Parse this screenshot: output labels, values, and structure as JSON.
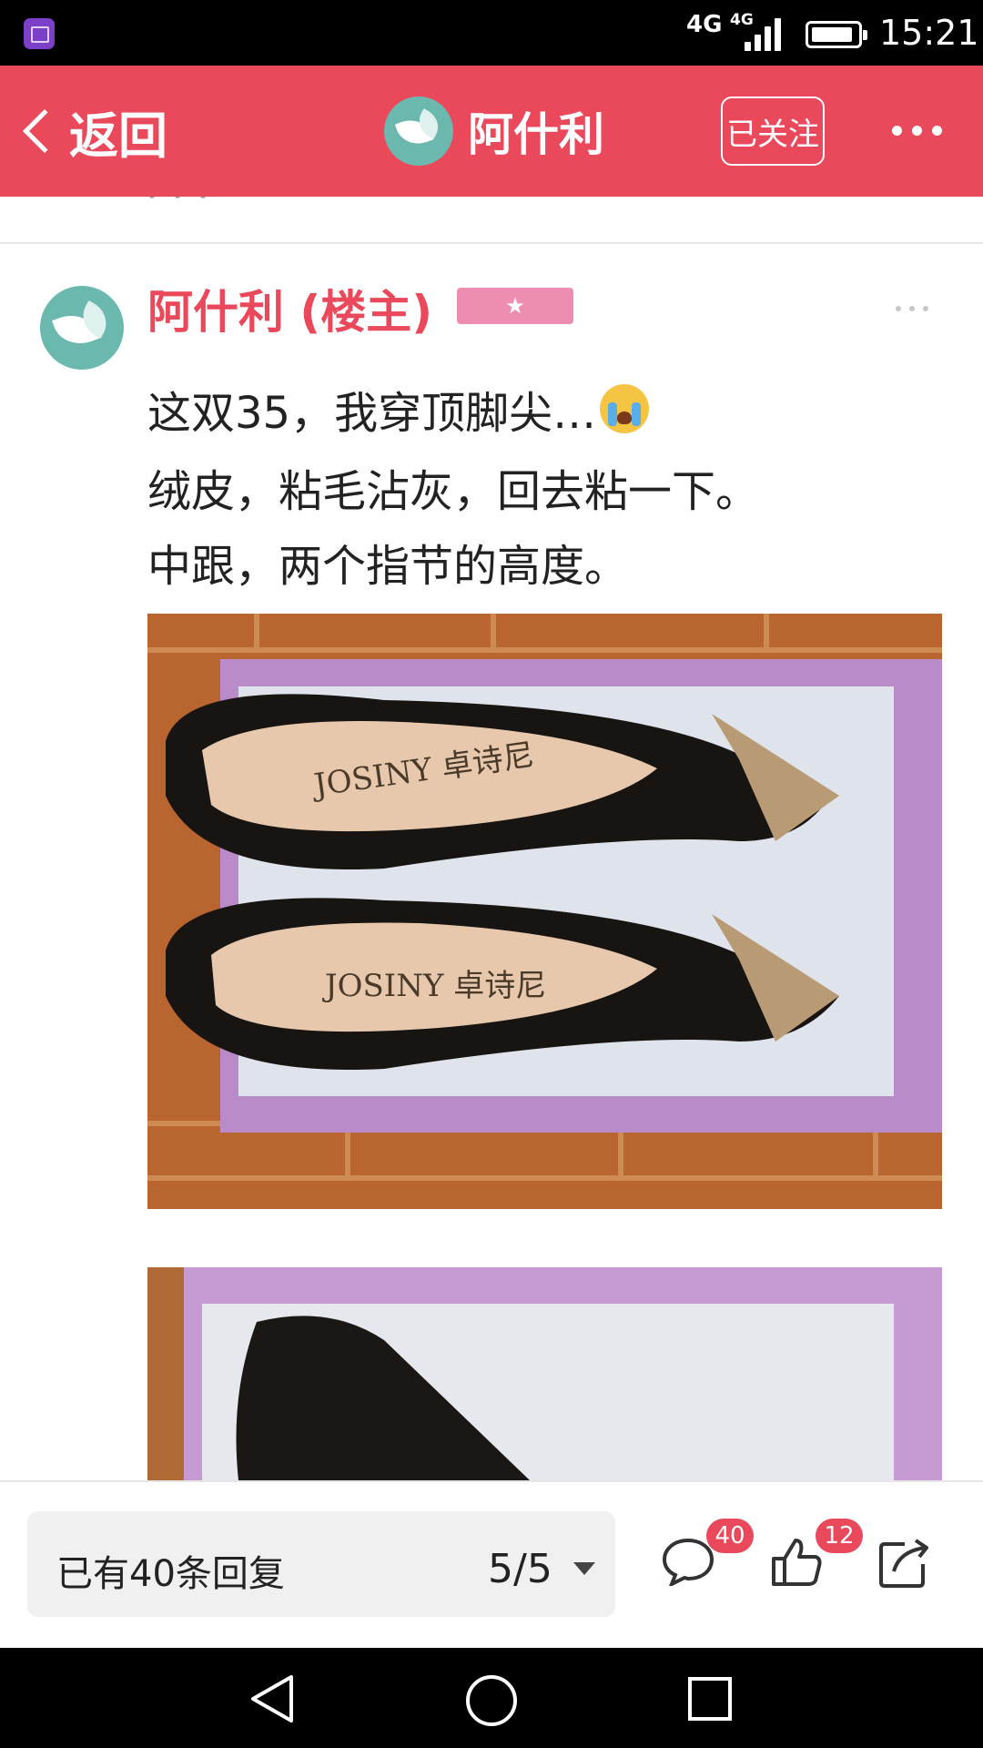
{
  "status_bar": {
    "network_1": "4G",
    "network_2": "4G",
    "time": "15:21"
  },
  "navbar": {
    "back_label": "返回",
    "title": "阿什利",
    "follow_label": "已关注",
    "brand_color": "#e9495b"
  },
  "post": {
    "author": "阿什利 (楼主)",
    "badge_icon": "star-icon",
    "lines": [
      "这双35，我穿顶脚尖…",
      "绒皮，粘毛沾灰，回去粘一下。",
      "中跟，两个指节的高度。"
    ],
    "emoji": "crying-face-emoji",
    "photo_brand_text": "JOSINY 卓诗尼"
  },
  "bottom_bar": {
    "reply_count": "已有40条回复",
    "page_indicator": "5/5",
    "comment_badge": "40",
    "like_badge": "12"
  }
}
